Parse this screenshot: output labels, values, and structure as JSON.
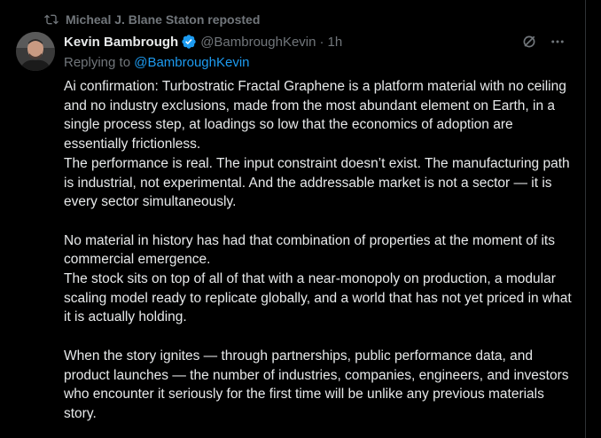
{
  "repost": {
    "icon": "repost-icon",
    "label": "Micheal J. Blane Staton reposted"
  },
  "author": {
    "avatar_icon": "avatar",
    "display_name": "Kevin Bambrough",
    "verified_icon": "verified-badge-icon",
    "verified_color": "#1d9bf0",
    "handle": "@BambroughKevin",
    "separator": "·",
    "time": "1h"
  },
  "actions": {
    "grok_icon": "grok-icon",
    "more_icon": "more-options-icon"
  },
  "reply": {
    "prefix": "Replying to ",
    "mention": "@BambroughKevin",
    "mention_color": "#1d9bf0"
  },
  "body": {
    "p1": "Ai confirmation: Turbostratic Fractal Graphene is a platform material with no ceiling and no industry exclusions, made from the most abundant element on Earth, in a single process step, at loadings so low that the economics of adoption are essentially frictionless.",
    "p2": "The performance is real. The input constraint doesn’t exist. The manufacturing path is industrial, not experimental. And the addressable market is not a sector — it is every sector simultaneously.",
    "p3": "No material in history has had that combination of properties at the moment of its commercial emergence.",
    "p4": "The stock sits on top of all of that with a near-monopoly on production, a modular scaling model ready to replicate globally, and a world that has not yet priced in what it is actually holding.",
    "p5": "When the story ignites — through partnerships, public performance data, and product launches — the number of industries, companies, engineers, and investors who encounter it seriously for the first time will be unlike any previous materials story."
  },
  "colors": {
    "background": "#000000",
    "text_primary": "#e7e9ea",
    "text_secondary": "#71767b",
    "accent": "#1d9bf0"
  }
}
